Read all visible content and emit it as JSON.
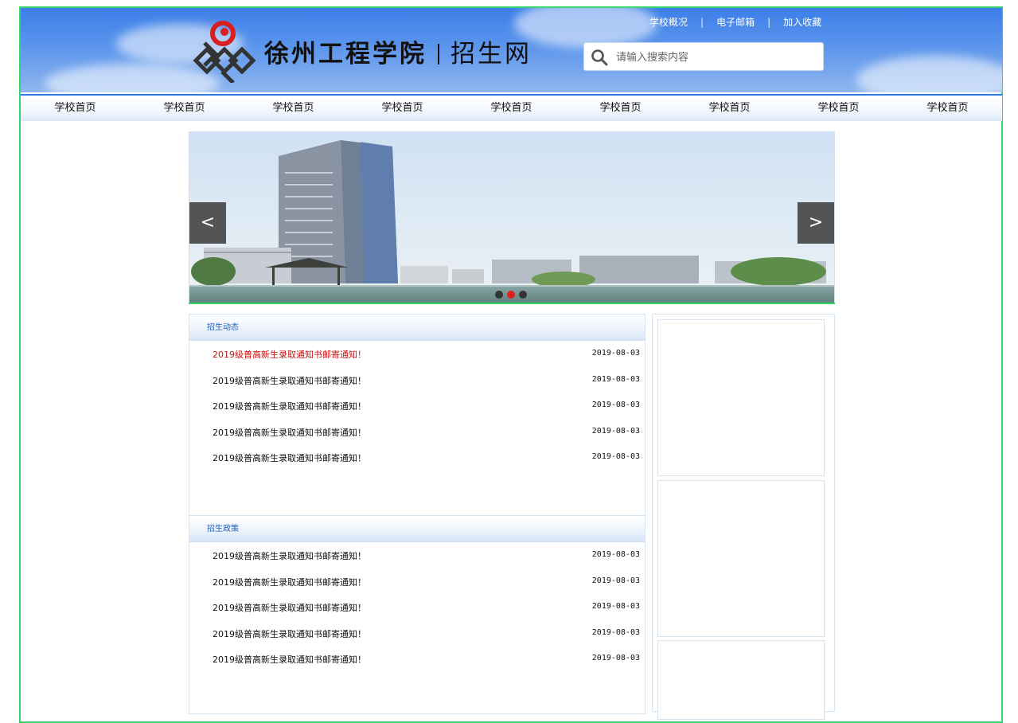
{
  "header": {
    "school_name": "徐州工程学院",
    "site_name": "招生网",
    "top_links": [
      "学校概况",
      "电子邮箱",
      "加入收藏"
    ],
    "separator": "|",
    "search": {
      "placeholder": "请输入搜索内容",
      "value": "",
      "icon": "search-icon"
    }
  },
  "nav": {
    "items": [
      "学校首页",
      "学校首页",
      "学校首页",
      "学校首页",
      "学校首页",
      "学校首页",
      "学校首页",
      "学校首页",
      "学校首页"
    ]
  },
  "banner": {
    "prev_label": "<",
    "next_label": ">",
    "dots": 3,
    "active_dot": 1,
    "active_color": "#e02020"
  },
  "admission_news": {
    "title": "招生动态",
    "items": [
      {
        "title": "2019级普高新生录取通知书邮寄通知！",
        "date": "2019-08-03"
      },
      {
        "title": "2019级普高新生录取通知书邮寄通知！",
        "date": "2019-08-03"
      },
      {
        "title": "2019级普高新生录取通知书邮寄通知！",
        "date": "2019-08-03"
      },
      {
        "title": "2019级普高新生录取通知书邮寄通知！",
        "date": "2019-08-03"
      },
      {
        "title": "2019级普高新生录取通知书邮寄通知！",
        "date": "2019-08-03"
      }
    ]
  },
  "admission_policy": {
    "title": "招生政策",
    "items": [
      {
        "title": "2019级普高新生录取通知书邮寄通知！",
        "date": "2019-08-03"
      },
      {
        "title": "2019级普高新生录取通知书邮寄通知！",
        "date": "2019-08-03"
      },
      {
        "title": "2019级普高新生录取通知书邮寄通知！",
        "date": "2019-08-03"
      },
      {
        "title": "2019级普高新生录取通知书邮寄通知！",
        "date": "2019-08-03"
      },
      {
        "title": "2019级普高新生录取通知书邮寄通知！",
        "date": "2019-08-03"
      }
    ]
  },
  "colors": {
    "header_blue": "#3c7ee8",
    "nav_border": "#2c78e2",
    "frame_green": "#38d36a",
    "highlight_red": "#cc1111",
    "panel_title": "#1f5fb8"
  }
}
